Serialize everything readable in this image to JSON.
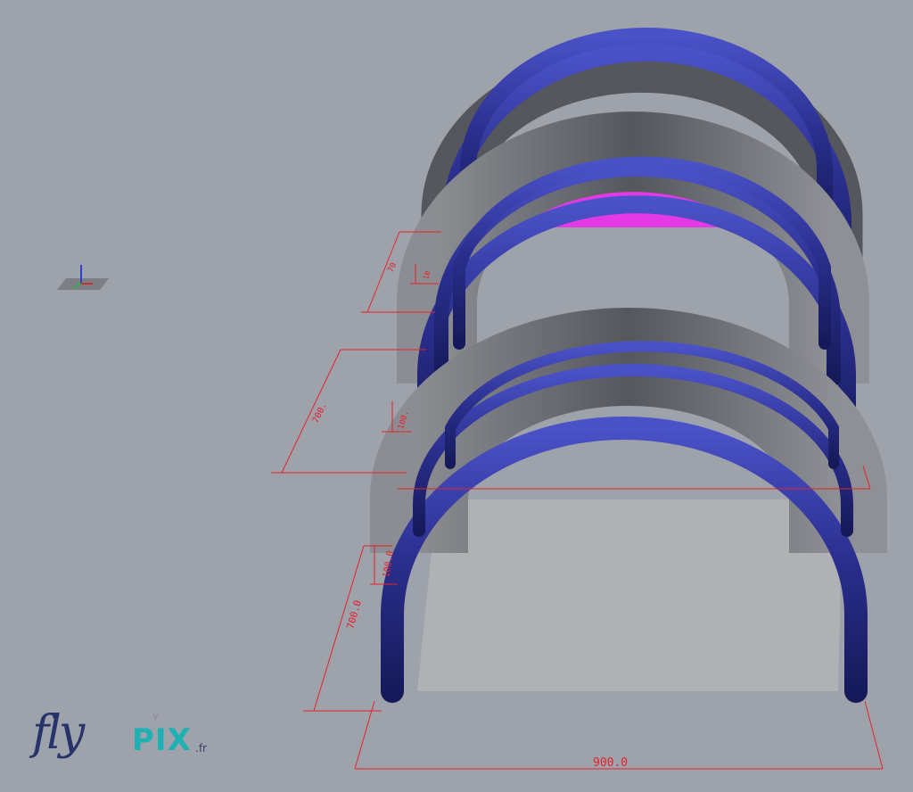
{
  "dimensions": {
    "width": "900.0",
    "height_total": "700.0",
    "height_tube": "100.0",
    "mid_height": "700.",
    "mid_tube": "100.",
    "back_height": "70",
    "back_tube": "10"
  },
  "logo": {
    "fly": "fly",
    "pix": "PIX",
    "fr": ".fr"
  },
  "colors": {
    "background": "#9ea2ab",
    "tube": "#2a2f8e",
    "canvas": "#5d5f66",
    "inner_wall": "#e33ae6",
    "dimension": "#e8202a",
    "floor": "#b0b1b5"
  }
}
